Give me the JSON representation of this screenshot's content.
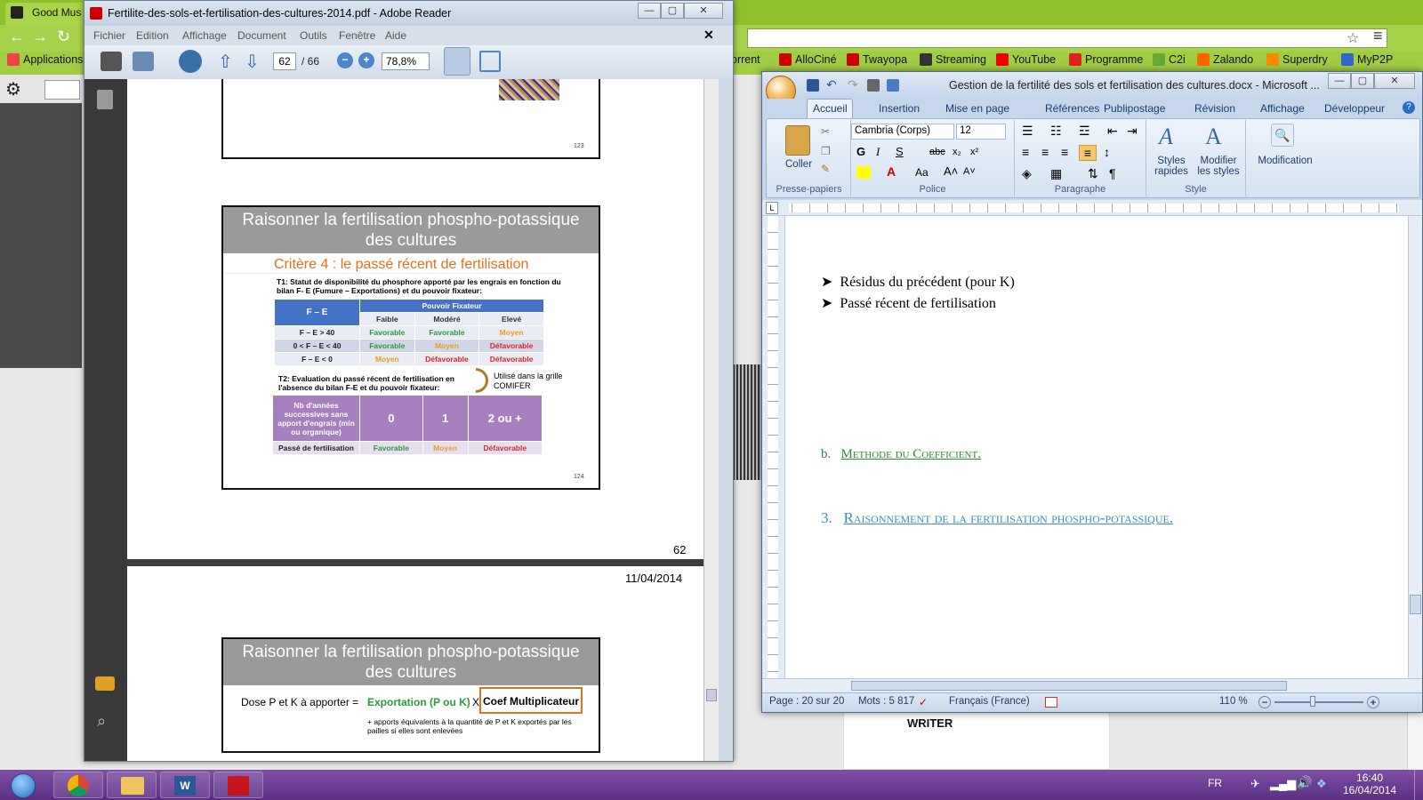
{
  "browser": {
    "tab_title": "Good Mus",
    "apps_label": "Applications",
    "bookmarks": [
      {
        "label": "orrent",
        "color": "#c23"
      },
      {
        "label": "AlloCiné",
        "color": "#c00"
      },
      {
        "label": "Twayopa",
        "color": "#c00"
      },
      {
        "label": "Streaming",
        "color": "#333"
      },
      {
        "label": "YouTube",
        "color": "#e00"
      },
      {
        "label": "Programme",
        "color": "#d22"
      },
      {
        "label": "C2i",
        "color": "#6a3"
      },
      {
        "label": "Zalando",
        "color": "#f60"
      },
      {
        "label": "Superdry",
        "color": "#f80"
      },
      {
        "label": "MyP2P",
        "color": "#36c"
      }
    ],
    "bg_text": "WRITER"
  },
  "reader": {
    "title": "Fertilite-des-sols-et-fertilisation-des-cultures-2014.pdf - Adobe Reader",
    "menu": [
      "Fichier",
      "Edition",
      "Affichage",
      "Document",
      "Outils",
      "Fenêtre",
      "Aide"
    ],
    "page_current": "62",
    "page_total": "/ 66",
    "zoom": "78,8%",
    "page_number_label": "62",
    "date_label": "11/04/2014",
    "slide123_num": "123",
    "slide124": {
      "title": "Raisonner la fertilisation phospho-potassique des cultures",
      "subtitle": "Critère 4 : le passé récent de fertilisation",
      "t1": "T1: Statut de disponibilité du phosphore apporté par les engrais en fonction du bilan F- E (Fumure – Exportations) et du pouvoir fixateur:",
      "t1_head": "F – E",
      "t1_group": "Pouvoir Fixateur",
      "t1_cols": [
        "Faible",
        "Modéré",
        "Elevé"
      ],
      "t1_rows": [
        {
          "label": "F – E > 40",
          "vals": [
            "Favorable",
            "Favorable",
            "Moyen"
          ]
        },
        {
          "label": "0 < F – E < 40",
          "vals": [
            "Favorable",
            "Moyen",
            "Défavorable"
          ]
        },
        {
          "label": "F – E < 0",
          "vals": [
            "Moyen",
            "Défavorable",
            "Défavorable"
          ]
        }
      ],
      "t2": "T2: Evaluation du passé récent de fertilisation en l'absence du bilan F-E et du pouvoir fixateur:",
      "note": "Utilisé dans la grille COMIFER",
      "t2_head": "Nb d'années successives sans apport d'engrais (min ou organique)",
      "t2_cols": [
        "0",
        "1",
        "2 ou +"
      ],
      "t2_row_label": "Passé de fertilisation",
      "t2_vals": [
        "Favorable",
        "Moyen",
        "Défavorable"
      ],
      "num": "124"
    },
    "slide125": {
      "title": "Raisonner la fertilisation phospho-potassique des cultures",
      "dose": "Dose P et K à apporter =",
      "export": "Exportation (P ou K)",
      "x": "X",
      "coef": "Coef  Multiplicateur",
      "note": "+ apports équivalents à la quantité de P et K exportés par les pailles si elles sont enlevées"
    }
  },
  "word": {
    "title": "Gestion de la fertilité des sols et fertilisation des cultures.docx - Microsoft ...",
    "tabs": [
      "Accueil",
      "Insertion",
      "Mise en page",
      "Références",
      "Publipostage",
      "Révision",
      "Affichage",
      "Développeur"
    ],
    "font_name": "Cambria (Corps)",
    "font_size": "12",
    "groups": [
      "Presse-papiers",
      "Police",
      "Paragraphe",
      "Style"
    ],
    "paste_label": "Coller",
    "styles_label": "Styles rapides",
    "modify_styles_label": "Modifier les styles",
    "modification_label": "Modification",
    "bullets": [
      "Résidus du précédent (pour K)",
      "Passé récent de fertilisation"
    ],
    "heading_b_num": "b.",
    "heading_b": "Methode du Coefficient.",
    "heading_3_num": "3.",
    "heading_3": "Raisonnement de la fertilisation phospho-potassique.",
    "status_page": "Page : 20 sur 20",
    "status_words": "Mots : 5 817",
    "status_lang": "Français (France)",
    "zoom": "110 %"
  },
  "taskbar": {
    "lang": "FR",
    "time": "16:40",
    "date": "16/04/2014"
  }
}
